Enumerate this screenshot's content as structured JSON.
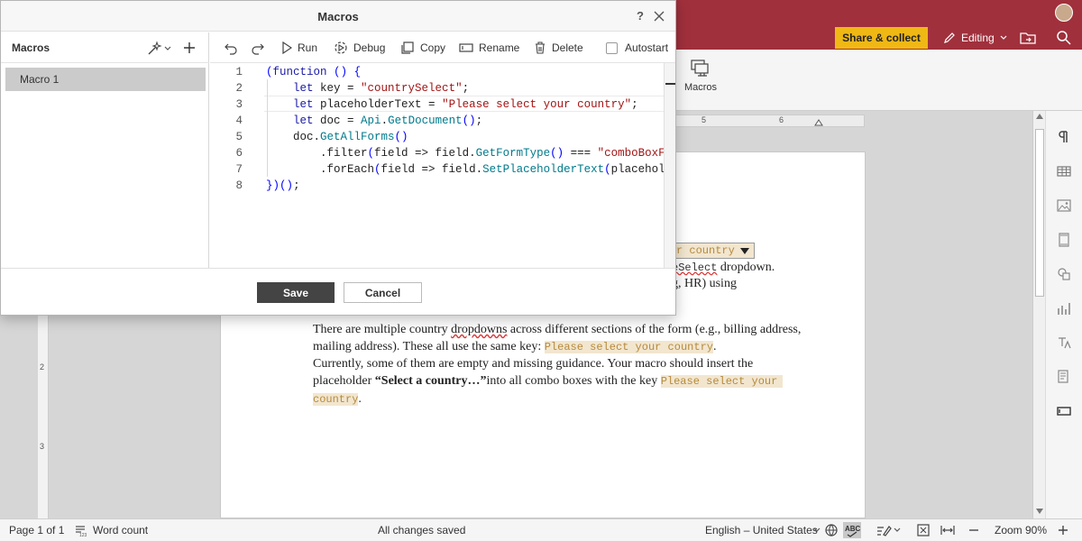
{
  "editor": {
    "share_label": "Share & collect",
    "editing_label": "Editing",
    "ribbon_macros_label": "Macros",
    "ruler_marks": [
      "5",
      "6"
    ],
    "ruler_vmarks": [
      "2",
      "3"
    ]
  },
  "document": {
    "combo_text": "r country",
    "line1_code": "eSelect",
    "line1_rest": "dropdown.",
    "line2": "g, HR) using",
    "p1_a": "There are multiple country ",
    "p1_link": "dropdowns",
    "p1_b": " across different sections of the form (e.g., billing address,",
    "p2": "mailing address). These all use the same key: ",
    "p2_code": "Please select your country",
    "p2_end": ".",
    "p3": "Currently, some of them are empty and missing guidance. Your macro should insert the",
    "p4_a": "placeholder ",
    "p4_bold": "“Select a country…”",
    "p4_b": "into all combo boxes with the key ",
    "p4_code": "Please select your",
    "p5_code": "country",
    "p5_end": "."
  },
  "statusbar": {
    "page": "Page 1 of 1",
    "word_count": "Word count",
    "saved": "All changes saved",
    "language": "English – United States",
    "zoom": "Zoom 90%"
  },
  "dialog": {
    "title": "Macros",
    "help": "?",
    "left_heading": "Macros",
    "macros": [
      {
        "name": "Macro 1",
        "selected": true
      }
    ],
    "toolbar": {
      "run": "Run",
      "debug": "Debug",
      "copy": "Copy",
      "rename": "Rename",
      "delete": "Delete",
      "autostart": "Autostart",
      "autostart_checked": false
    },
    "code_lines": [
      {
        "n": "1",
        "code": "(function () {"
      },
      {
        "n": "2",
        "code": "    let key = \"countrySelect\";"
      },
      {
        "n": "3",
        "code": "    let placeholderText = \"Please select your country\";"
      },
      {
        "n": "4",
        "code": "    let doc = Api.GetDocument();"
      },
      {
        "n": "5",
        "code": "    doc.GetAllForms()"
      },
      {
        "n": "6",
        "code": "        .filter(field => field.GetFormType() === \"comboBoxForm\""
      },
      {
        "n": "7",
        "code": "        .forEach(field => field.SetPlaceholderText(placeholderT"
      },
      {
        "n": "8",
        "code": "})();"
      }
    ],
    "save": "Save",
    "cancel": "Cancel"
  }
}
